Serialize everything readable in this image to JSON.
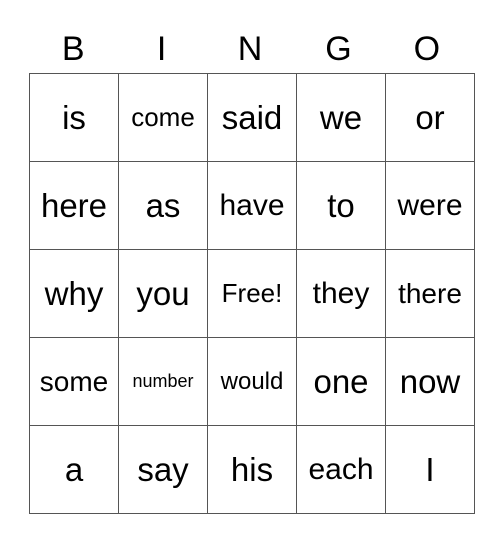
{
  "header": [
    "B",
    "I",
    "N",
    "G",
    "O"
  ],
  "rows": [
    [
      "is",
      "come",
      "said",
      "we",
      "or"
    ],
    [
      "here",
      "as",
      "have",
      "to",
      "were"
    ],
    [
      "why",
      "you",
      "Free!",
      "they",
      "there"
    ],
    [
      "some",
      "number",
      "would",
      "one",
      "now"
    ],
    [
      "a",
      "say",
      "his",
      "each",
      "I"
    ]
  ]
}
